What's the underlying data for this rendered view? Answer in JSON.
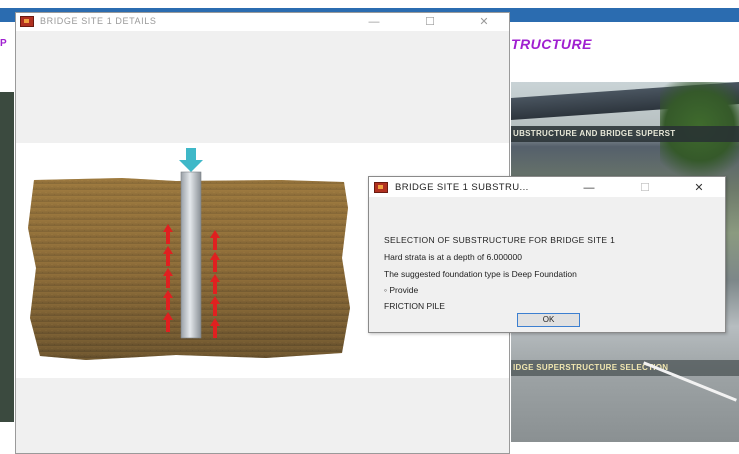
{
  "background_app": {
    "title": "TRUCTURE",
    "left_edge_letter": "P",
    "banner_1": "UBSTRUCTURE AND BRIDGE SUPERST",
    "banner_2": "IDGE SUPERSTRUCTURE SELECTION"
  },
  "details_window": {
    "title": "BRIDGE SITE 1 DETAILS",
    "controls": {
      "minimize": "—",
      "maximize": "☐",
      "close": "✕"
    }
  },
  "substructure_dialog": {
    "title": "BRIDGE SITE 1 SUBSTRU...",
    "controls": {
      "minimize": "—",
      "maximize": "☐",
      "close": "✕"
    },
    "heading": "SELECTION OF SUBSTRUCTURE FOR BRIDGE SITE 1",
    "line1": "Hard strata is at a depth of 6.000000",
    "line2": "The suggested foundation type is Deep Foundation",
    "provide_label": "Provide",
    "pile_type": "FRICTION PILE",
    "ok_label": "OK"
  },
  "colors": {
    "soil": "#8a6a38",
    "pile": "#c8ccd0",
    "load_arrow": "#3fb8c8",
    "friction_arrows": "#e02020",
    "title_accent": "#a020d0",
    "os_taskbar": "#2b6cb0"
  },
  "icons": {
    "app_icon": "matlab-figure-icon",
    "load_arrow": "down-arrow-icon",
    "friction_arrows": "up-arrow-icon"
  }
}
